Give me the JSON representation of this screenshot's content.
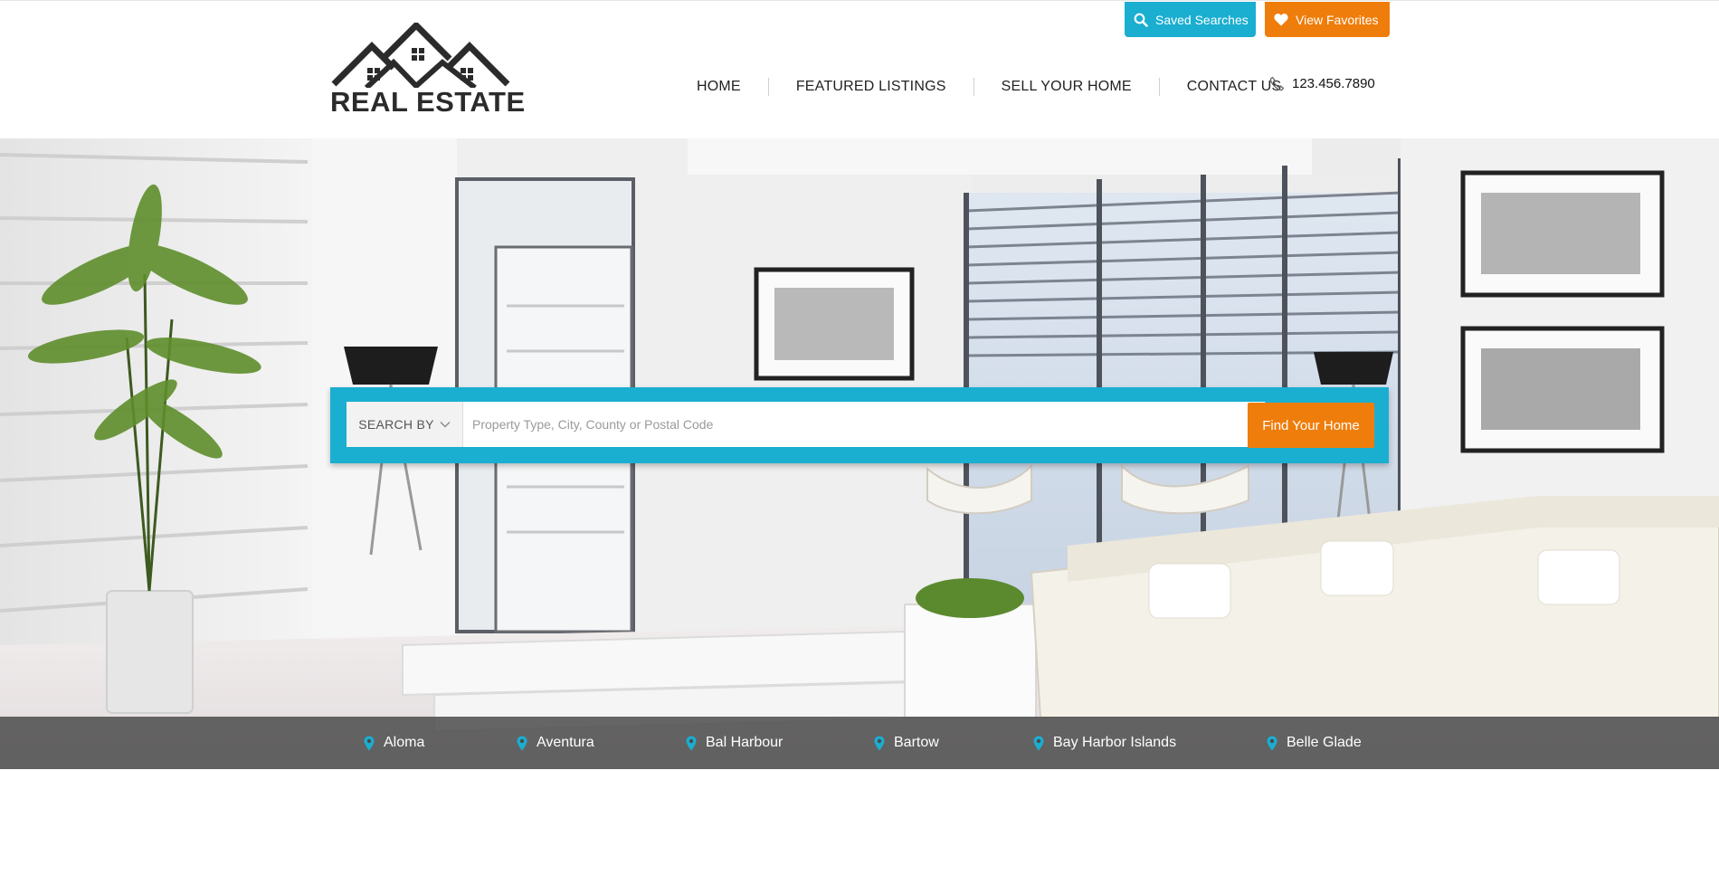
{
  "header": {
    "logo_text": "REAL ESTATE",
    "top_buttons": {
      "saved_searches": "Saved Searches",
      "view_favorites": "View Favorites"
    },
    "nav": {
      "items": [
        "HOME",
        "FEATURED LISTINGS",
        "SELL YOUR HOME",
        "CONTACT US"
      ]
    },
    "phone": "123.456.7890"
  },
  "search": {
    "search_by_label": "SEARCH BY",
    "placeholder": "Property Type, City, County or Postal Code",
    "submit_label": "Find Your Home"
  },
  "cities": [
    "Aloma",
    "Aventura",
    "Bal Harbour",
    "Bartow",
    "Bay Harbor Islands",
    "Belle Glade"
  ],
  "colors": {
    "accent_blue": "#1aaed0",
    "accent_orange": "#ef7d0b",
    "text_dark": "#222222"
  },
  "icons": {
    "saved_searches": "search-icon",
    "view_favorites": "heart-icon",
    "phone": "phone-icon",
    "search_by": "chevron-down-icon",
    "city": "map-pin-icon"
  }
}
